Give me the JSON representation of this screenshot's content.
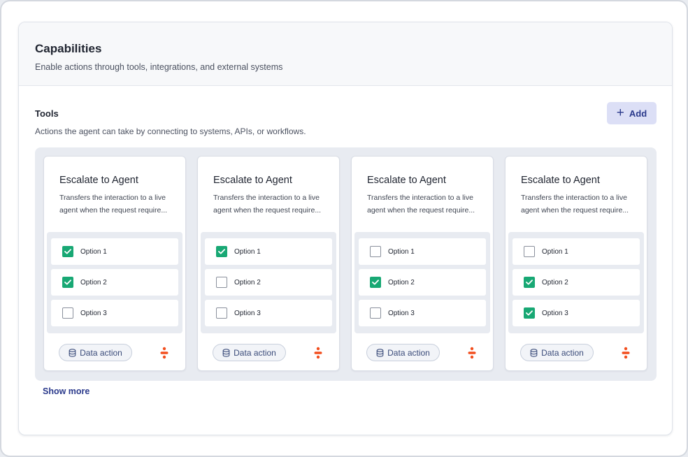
{
  "panel": {
    "title": "Capabilities",
    "subtitle": "Enable actions through tools, integrations, and external systems"
  },
  "tools": {
    "title": "Tools",
    "description": "Actions the agent can take by connecting to systems, APIs, or workflows.",
    "add_label": "Add",
    "show_more_label": "Show more",
    "cards": [
      {
        "title": "Escalate to Agent",
        "description": "Transfers the interaction to a live agent when the request require...",
        "options": [
          {
            "label": "Option 1",
            "checked": true
          },
          {
            "label": "Option 2",
            "checked": true
          },
          {
            "label": "Option 3",
            "checked": false
          }
        ],
        "chip_label": "Data action"
      },
      {
        "title": "Escalate to Agent",
        "description": "Transfers the interaction to a live agent when the request require...",
        "options": [
          {
            "label": "Option 1",
            "checked": true
          },
          {
            "label": "Option 2",
            "checked": false
          },
          {
            "label": "Option 3",
            "checked": false
          }
        ],
        "chip_label": "Data action"
      },
      {
        "title": "Escalate to Agent",
        "description": "Transfers the interaction to a live agent when the request require...",
        "options": [
          {
            "label": "Option 1",
            "checked": false
          },
          {
            "label": "Option 2",
            "checked": true
          },
          {
            "label": "Option 3",
            "checked": false
          }
        ],
        "chip_label": "Data action"
      },
      {
        "title": "Escalate to Agent",
        "description": "Transfers the interaction to a live agent when the request require...",
        "options": [
          {
            "label": "Option 1",
            "checked": false
          },
          {
            "label": "Option 2",
            "checked": true
          },
          {
            "label": "Option 3",
            "checked": true
          }
        ],
        "chip_label": "Data action"
      }
    ]
  },
  "icons": {
    "add": "plus-icon",
    "chip": "database-icon",
    "brand": "brand-logo-icon",
    "check": "checkmark-icon"
  },
  "colors": {
    "accent": "#2b3a8c",
    "add_button_bg": "#dcdff6",
    "checkbox_checked": "#18a874",
    "brand_icon": "#f24e1e"
  }
}
